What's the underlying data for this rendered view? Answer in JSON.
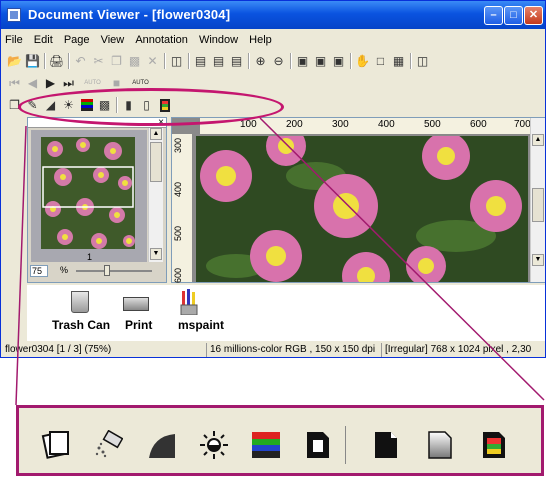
{
  "window": {
    "title": "Document Viewer - [flower0304]"
  },
  "menu": [
    "File",
    "Edit",
    "Page",
    "View",
    "Annotation",
    "Window",
    "Help"
  ],
  "thumbnail": {
    "page_label": "1",
    "zoom_value": "75",
    "zoom_unit": "%"
  },
  "ruler": {
    "h_ticks": [
      "100",
      "200",
      "300",
      "400",
      "500",
      "600",
      "700"
    ],
    "v_ticks": [
      "300",
      "400",
      "500",
      "600"
    ]
  },
  "desktop_icons": [
    {
      "label": "Trash Can",
      "icon": "trash-can-icon"
    },
    {
      "label": "Print",
      "icon": "printer-icon"
    },
    {
      "label": "mspaint",
      "icon": "paint-brushes-icon"
    }
  ],
  "status": {
    "file": "flower0304 [1 / 3] (75%)",
    "color": "16 millions-color RGB ,  150 x 150 dpi",
    "size": "[Irregular]  768 x 1024 pixel , 2,30"
  },
  "zoom_tools": [
    "crop-pages-icon",
    "eraser-icon",
    "curve-adjust-icon",
    "brightness-icon",
    "color-balance-icon",
    "invert-page-icon",
    "black-page-icon",
    "gray-page-icon",
    "color-page-icon"
  ],
  "colors": {
    "highlight": "#c4166f",
    "title_bar": "#0a53e0"
  }
}
